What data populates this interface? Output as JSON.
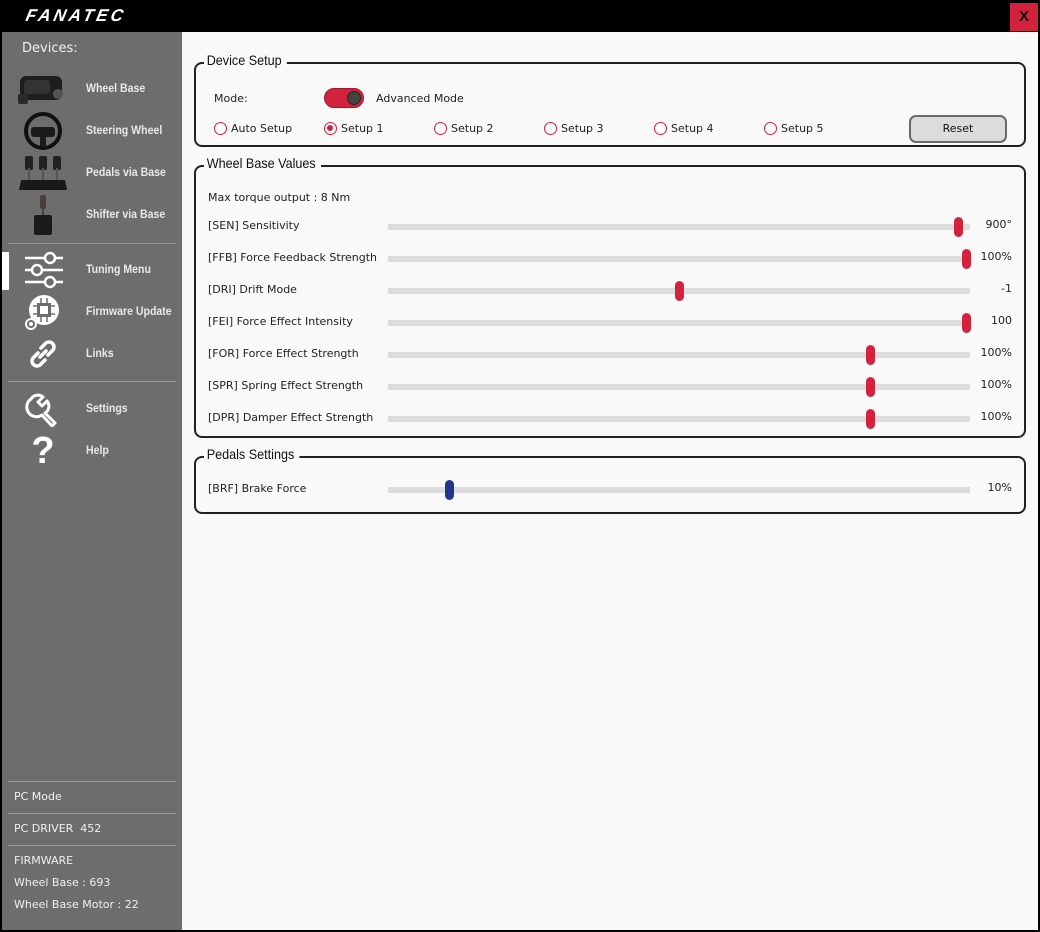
{
  "app": {
    "logo": "FANATEC",
    "close_label": "X",
    "accent_color": "#d2223c",
    "pedal_accent_color": "#24358c"
  },
  "sidebar": {
    "heading": "Devices:",
    "devices": [
      {
        "label": "Wheel Base",
        "icon": "wheel-base-image"
      },
      {
        "label": "Steering Wheel",
        "icon": "steering-wheel-image"
      },
      {
        "label": "Pedals via Base",
        "icon": "pedals-image"
      },
      {
        "label": "Shifter via Base",
        "icon": "shifter-image"
      }
    ],
    "menu": [
      {
        "label": "Tuning Menu",
        "icon": "sliders-icon",
        "active": true
      },
      {
        "label": "Firmware Update",
        "icon": "chip-icon"
      },
      {
        "label": "Links",
        "icon": "link-icon"
      }
    ],
    "extra": [
      {
        "label": "Settings",
        "icon": "wrench-icon"
      },
      {
        "label": "Help",
        "icon": "question-icon"
      }
    ],
    "pc_mode": "PC Mode",
    "pc_driver_label": "PC DRIVER",
    "pc_driver_value": "452",
    "firmware_heading": "FIRMWARE",
    "firmware_wheel_base": "Wheel Base : 693",
    "firmware_motor": "Wheel Base Motor : 22"
  },
  "device_setup": {
    "title": "Device Setup",
    "mode_label": "Mode:",
    "mode_value": "Advanced Mode",
    "mode_on": true,
    "setups": [
      {
        "label": "Auto Setup",
        "selected": false
      },
      {
        "label": "Setup 1",
        "selected": true
      },
      {
        "label": "Setup 2",
        "selected": false
      },
      {
        "label": "Setup 3",
        "selected": false
      },
      {
        "label": "Setup 4",
        "selected": false
      },
      {
        "label": "Setup 5",
        "selected": false
      }
    ],
    "reset_label": "Reset"
  },
  "wheel_base_values": {
    "title": "Wheel Base Values",
    "max_torque": "Max torque output :  8 Nm",
    "sliders": [
      {
        "label": "[SEN] Sensitivity",
        "value": "900°",
        "fraction": 0.98
      },
      {
        "label": "[FFB] Force Feedback Strength",
        "value": "100%",
        "fraction": 0.993
      },
      {
        "label": "[DRI] Drift Mode",
        "value": "-1",
        "fraction": 0.5
      },
      {
        "label": "[FEI] Force Effect Intensity",
        "value": "100",
        "fraction": 0.993
      },
      {
        "label": "[FOR] Force Effect Strength",
        "value": "100%",
        "fraction": 0.828
      },
      {
        "label": "[SPR] Spring Effect Strength",
        "value": "100%",
        "fraction": 0.828
      },
      {
        "label": "[DPR] Damper Effect Strength",
        "value": "100%",
        "fraction": 0.828
      }
    ]
  },
  "pedals_settings": {
    "title": "Pedals Settings",
    "sliders": [
      {
        "label": "[BRF] Brake Force",
        "value": "10%",
        "fraction": 0.105
      }
    ]
  }
}
